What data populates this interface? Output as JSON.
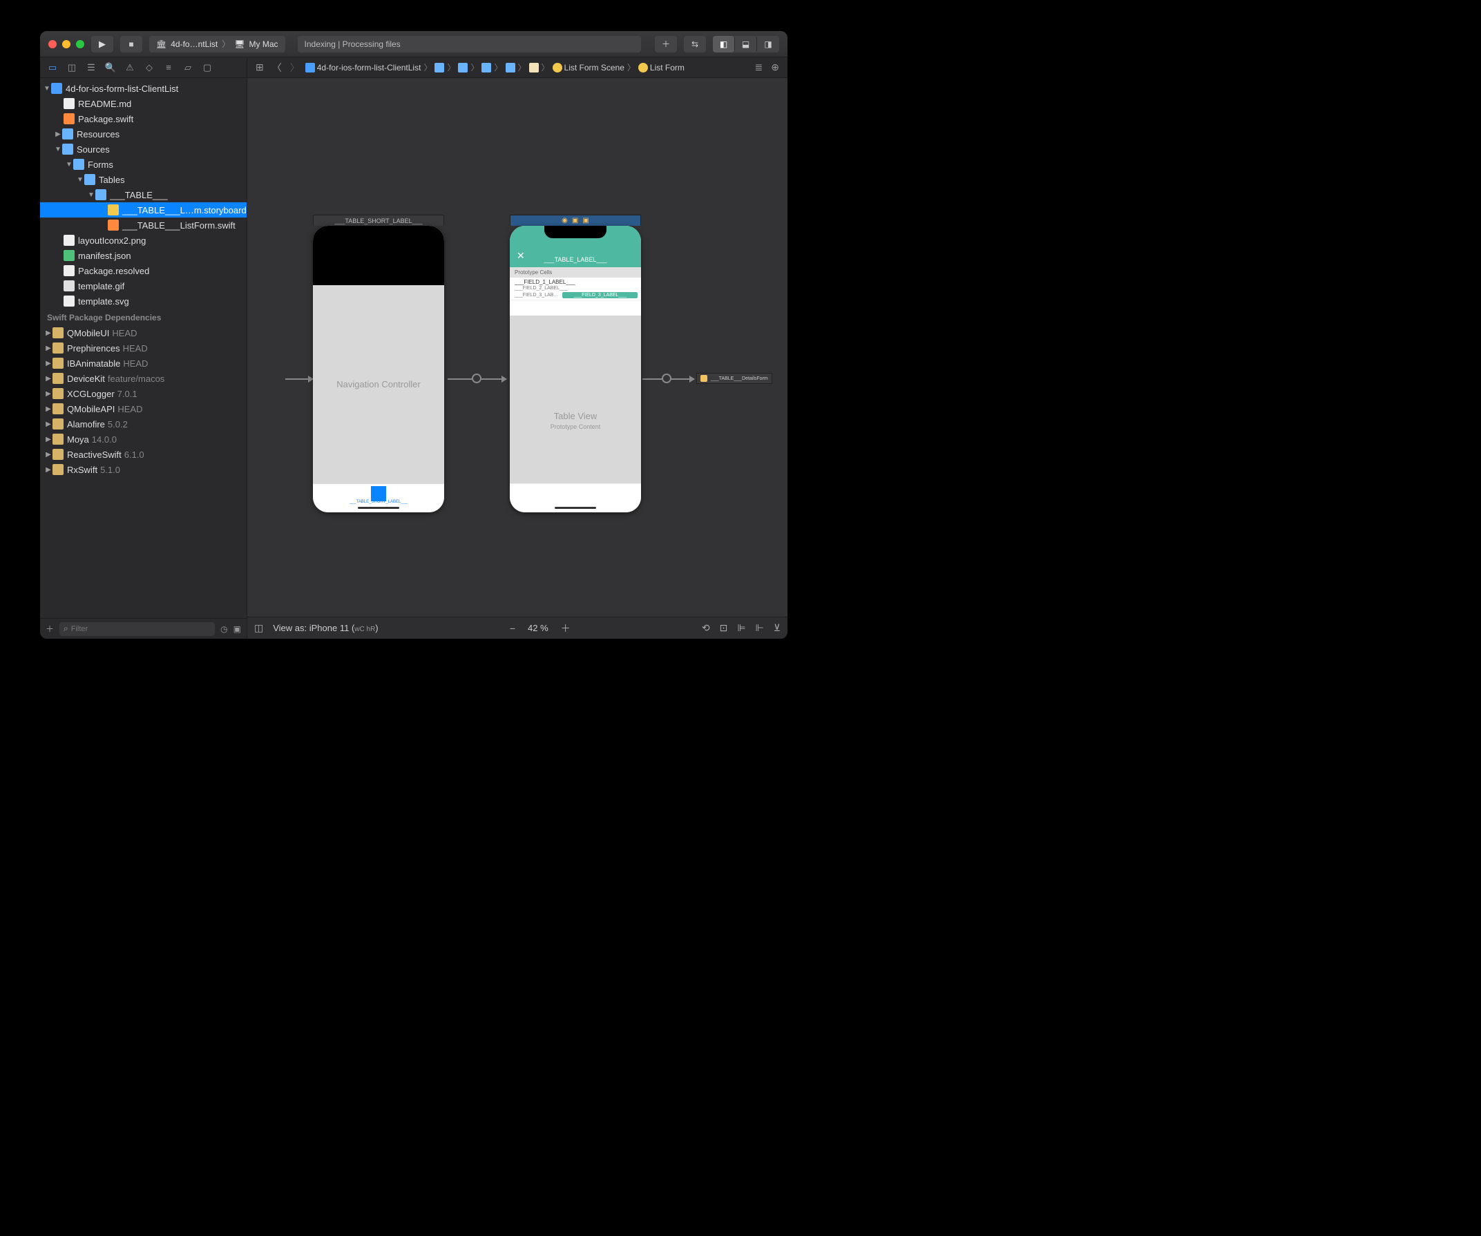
{
  "titlebar": {
    "scheme_project": "4d-fo…ntList",
    "scheme_target": "My Mac",
    "activity": "Indexing | Processing files"
  },
  "jumpbar": {
    "crumbs": [
      {
        "icon": "bluebox",
        "label": "4d-for-ios-form-list-ClientList"
      },
      {
        "icon": "folderc",
        "label": ""
      },
      {
        "icon": "folderc",
        "label": ""
      },
      {
        "icon": "folderc",
        "label": ""
      },
      {
        "icon": "folderc",
        "label": ""
      },
      {
        "icon": "creamc",
        "label": ""
      },
      {
        "icon": "yellowc",
        "label": "List Form Scene"
      },
      {
        "icon": "yellowc",
        "label": "List Form"
      }
    ]
  },
  "navigator": {
    "project": "4d-for-ios-form-list-ClientList",
    "files": {
      "readme": "README.md",
      "package": "Package.swift",
      "resources": "Resources",
      "sources": "Sources",
      "forms": "Forms",
      "tables": "Tables",
      "table": "___TABLE___",
      "storyboard": "___TABLE___L…m.storyboard",
      "listformswift": "___TABLE___ListForm.swift",
      "layouticon": "layoutIconx2.png",
      "manifest": "manifest.json",
      "resolved": "Package.resolved",
      "templategif": "template.gif",
      "templatesvg": "template.svg"
    },
    "deps_header": "Swift Package Dependencies",
    "deps": [
      {
        "name": "QMobileUI",
        "ver": "HEAD"
      },
      {
        "name": "Prephirences",
        "ver": "HEAD"
      },
      {
        "name": "IBAnimatable",
        "ver": "HEAD"
      },
      {
        "name": "DeviceKit",
        "ver": "feature/macos"
      },
      {
        "name": "XCGLogger",
        "ver": "7.0.1"
      },
      {
        "name": "QMobileAPI",
        "ver": "HEAD"
      },
      {
        "name": "Alamofire",
        "ver": "5.0.2"
      },
      {
        "name": "Moya",
        "ver": "14.0.0"
      },
      {
        "name": "ReactiveSwift",
        "ver": "6.1.0"
      },
      {
        "name": "RxSwift",
        "ver": "5.1.0"
      }
    ],
    "filter_placeholder": "Filter"
  },
  "canvas": {
    "scene1_title": "___TABLE_SHORT_LABEL___",
    "navcontroller": "Navigation Controller",
    "tab_label": "___TABLE_SHORT_LABEL___",
    "scene2_header": "___TABLE_LABEL___",
    "proto_header": "Prototype Cells",
    "field1": "___FIELD_1_LABEL___",
    "field2": "___FIELD_2_LABEL___",
    "field3": "___FIELD_3_LAB…",
    "field3_badge": "___FIELD_3_LABEL___",
    "tableview": "Table View",
    "protocontent": "Prototype Content",
    "dest_ref": "___TABLE___DetailsForm"
  },
  "canvasbar": {
    "viewas_prefix": "View as: ",
    "viewas_device": "iPhone 11 (",
    "viewas_wc": "wC",
    "viewas_hr": " hR",
    "viewas_close": ")",
    "zoom": "42 %"
  }
}
